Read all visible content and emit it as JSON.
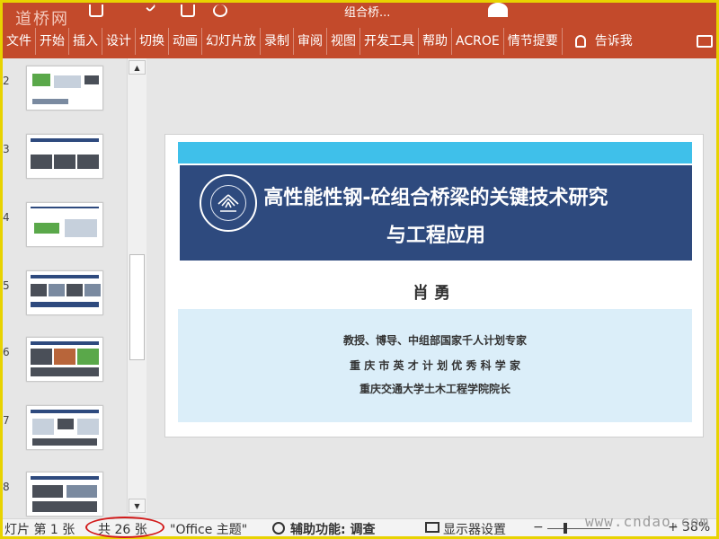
{
  "app": {
    "watermark_top": "道桥网",
    "doc_title": "组合桥...",
    "watermark_bottom": "www.cndao.com",
    "frame_color": "#e8d300",
    "ribbon_color": "#c34a2b"
  },
  "ribbon": {
    "tabs": [
      "文件",
      "开始",
      "插入",
      "设计",
      "切换",
      "动画",
      "幻灯片放",
      "录制",
      "审阅",
      "视图",
      "开发工具",
      "帮助",
      "ACROE",
      "情节提要"
    ],
    "tell_me": "告诉我"
  },
  "thumbnails": {
    "items": [
      {
        "num": "2"
      },
      {
        "num": "3"
      },
      {
        "num": "4"
      },
      {
        "num": "5"
      },
      {
        "num": "6"
      },
      {
        "num": "7"
      },
      {
        "num": "8"
      }
    ]
  },
  "slide": {
    "title_line1": "高性能性钢-砼组合桥梁的关键技术研究",
    "title_line2": "与工程应用",
    "author": "肖勇",
    "info1": "教授、博导、中组部国家千人计划专家",
    "info2": "重 庆 市 英 才 计 划 优 秀 科 学 家",
    "info3": "重庆交通大学土木工程学院院长",
    "title_band_color": "#2e4a7e",
    "logo_band_color": "#3fc0ea",
    "info_band_color": "#dbeef9"
  },
  "status": {
    "slide_pos": "灯片 第 1 张",
    "total": "共 26 张",
    "theme": "\"Office 主题\"",
    "accessibility": "辅助功能: 调查",
    "display": "显示器设置",
    "zoom_minus": "−",
    "zoom_plus": "+",
    "zoom": "38%"
  }
}
